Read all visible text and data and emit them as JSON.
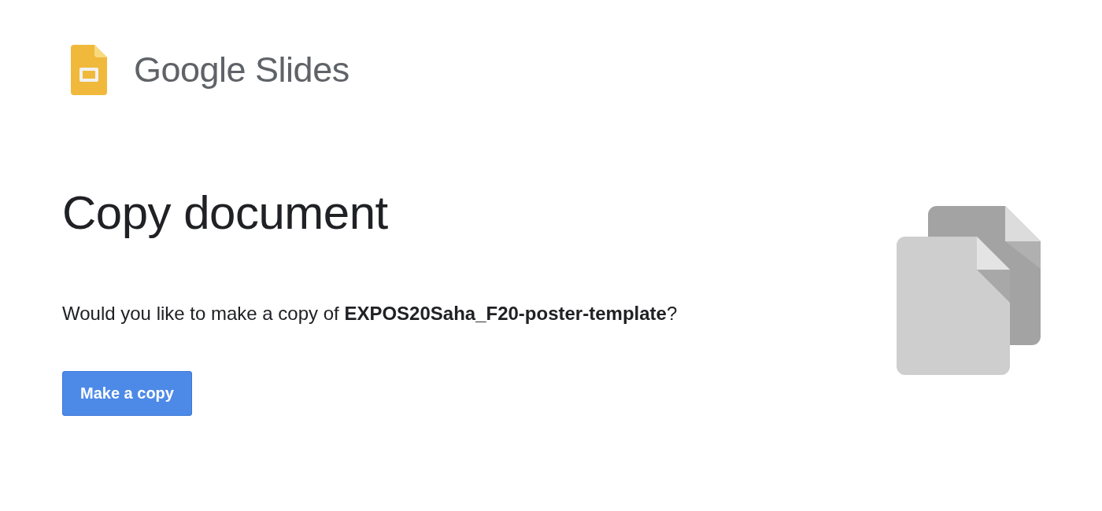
{
  "product": {
    "name": "Google Slides"
  },
  "dialog": {
    "title": "Copy document",
    "message": "Would you like to make a copy of **EXPOS20Saha_F20-poster-template**?",
    "button": "Make a copy"
  }
}
